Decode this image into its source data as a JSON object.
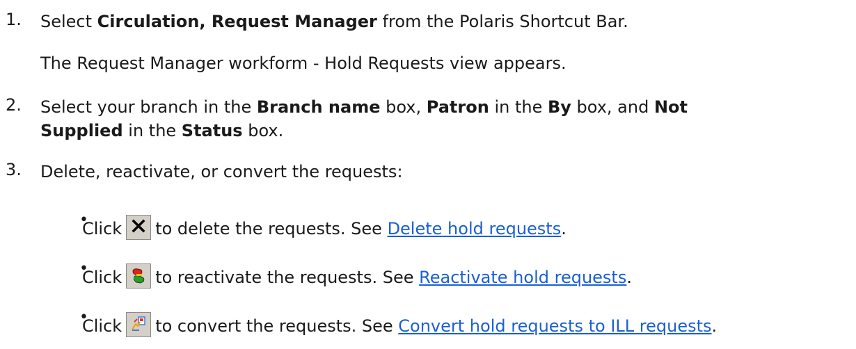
{
  "steps": [
    {
      "number": "1.",
      "line1_pre": "Select ",
      "line1_bold": "Circulation, Request Manager",
      "line1_post": " from the Polaris Shortcut Bar.",
      "line2": "The Request Manager workform - Hold Requests view appears."
    },
    {
      "number": "2.",
      "p1": "Select your branch in the ",
      "b1": "Branch name",
      "p2": " box, ",
      "b2": "Patron",
      "p3": " in the ",
      "b3": "By",
      "p4": " box, and ",
      "b4": "Not",
      "b5": "Supplied",
      "p5": " in the ",
      "b6": "Status",
      "p6": " box."
    },
    {
      "number": "3.",
      "text": "Delete, reactivate, or convert the requests:",
      "bullets": [
        {
          "bullet": "•",
          "click": "Click",
          "icon": "delete-x-icon",
          "text": "to delete the requests. See ",
          "link": "Delete hold requests",
          "end": "."
        },
        {
          "bullet": "•",
          "click": "Click",
          "icon": "reactivate-icon",
          "text": "to reactivate the requests. See ",
          "link": "Reactivate hold requests",
          "end": "."
        },
        {
          "bullet": "•",
          "click": "Click",
          "icon": "convert-ill-icon",
          "text": "to convert the requests. See ",
          "link": "Convert hold requests to ILL requests",
          "end": "."
        }
      ]
    }
  ]
}
